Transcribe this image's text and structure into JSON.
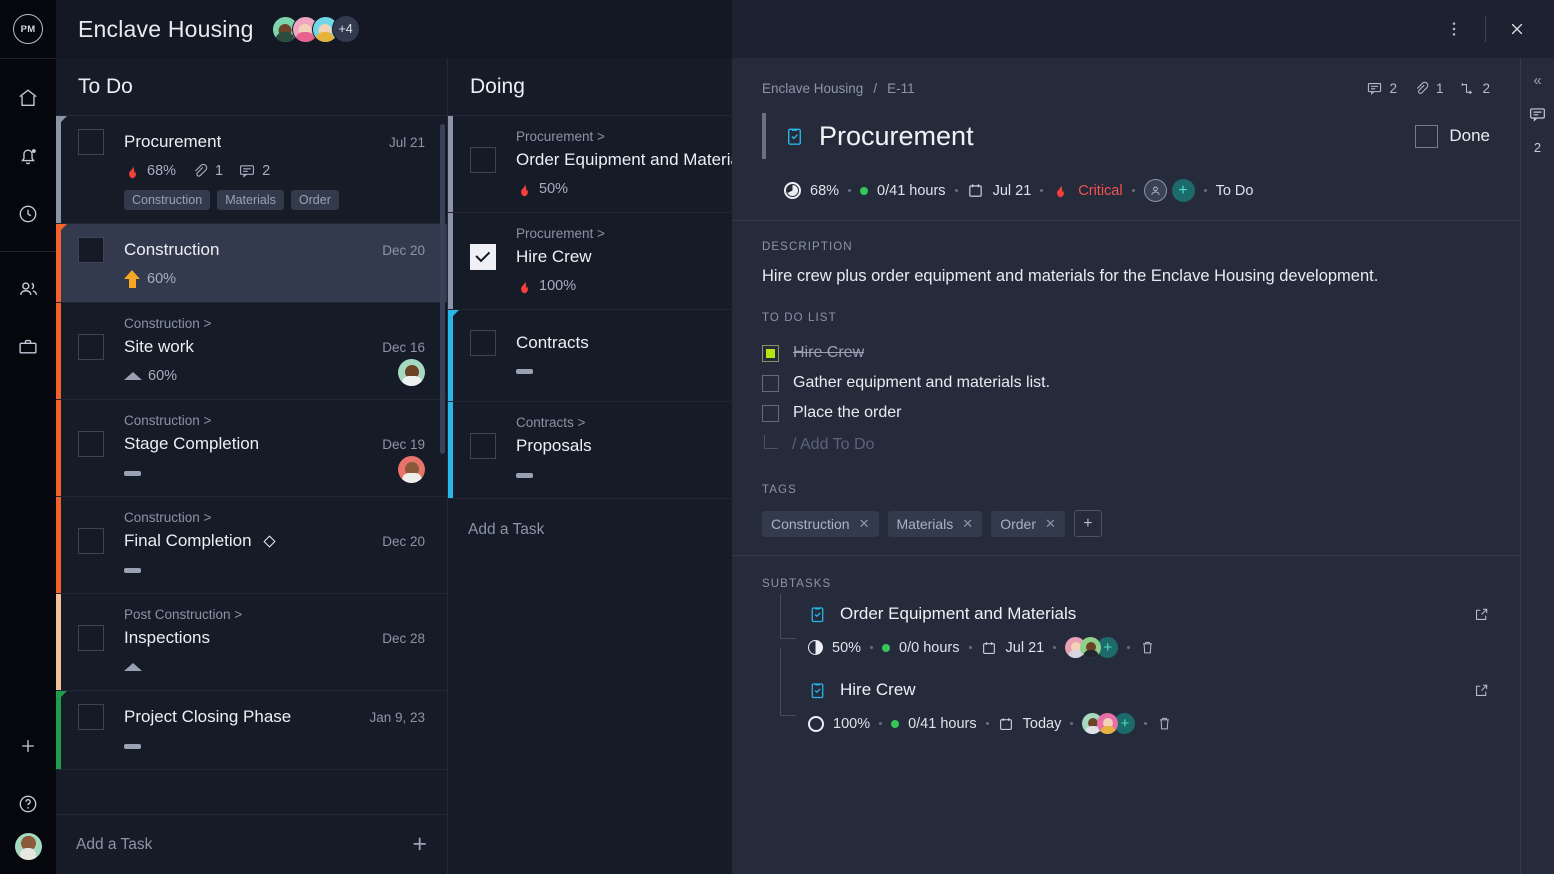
{
  "rail": {
    "logo_text": "PM",
    "items": [
      {
        "name": "home-icon",
        "label": "Home"
      },
      {
        "name": "bell-icon",
        "label": "Notifications"
      },
      {
        "name": "clock-icon",
        "label": "Recent"
      },
      {
        "name": "people-icon",
        "label": "People"
      },
      {
        "name": "briefcase-icon",
        "label": "Portfolio"
      }
    ],
    "add_label": "+",
    "help_label": "?"
  },
  "topbar": {
    "project_title": "Enclave Housing",
    "avatar_overflow": "+4",
    "views": [
      {
        "name": "list-view",
        "active": false
      },
      {
        "name": "board-view",
        "active": true
      },
      {
        "name": "gantt-view",
        "active": false
      }
    ]
  },
  "board": {
    "columns": [
      {
        "title": "To Do",
        "add_label": "Add a Task",
        "cards": [
          {
            "name": "Procurement",
            "parent": "",
            "date": "Jul 21",
            "selected": false,
            "checked": false,
            "strip": "#8d94a8",
            "priority": "flame",
            "progress": "68%",
            "attachments": "1",
            "comments": "2",
            "tags": [
              "Construction",
              "Materials",
              "Order"
            ],
            "avatar": ""
          },
          {
            "name": "Construction",
            "parent": "",
            "date": "Dec 20",
            "selected": true,
            "checked": false,
            "strip": "#f4622c",
            "priority": "arrow-up",
            "progress": "60%",
            "attachments": "",
            "comments": "",
            "tags": [],
            "avatar": ""
          },
          {
            "name": "Site work",
            "parent": "Construction >",
            "date": "Dec 16",
            "selected": false,
            "checked": false,
            "strip": "#f4622c",
            "priority": "triangle",
            "progress": "60%",
            "attachments": "",
            "comments": "",
            "tags": [],
            "avatar": "#a5d8c0"
          },
          {
            "name": "Stage Completion",
            "parent": "Construction >",
            "date": "Dec 19",
            "selected": false,
            "checked": false,
            "strip": "#f4622c",
            "priority": "dash",
            "progress": "",
            "attachments": "",
            "comments": "",
            "tags": [],
            "avatar": "#e8736b"
          },
          {
            "name": "Final Completion",
            "parent": "Construction >",
            "date": "Dec 20",
            "selected": false,
            "checked": false,
            "strip": "#f4622c",
            "priority": "dash",
            "progress": "",
            "milestone": true,
            "attachments": "",
            "comments": "",
            "tags": [],
            "avatar": ""
          },
          {
            "name": "Inspections",
            "parent": "Post Construction >",
            "date": "Dec 28",
            "selected": false,
            "checked": false,
            "strip": "#f3c49a",
            "priority": "triangle",
            "progress": "",
            "attachments": "",
            "comments": "",
            "tags": [],
            "avatar": ""
          },
          {
            "name": "Project Closing Phase",
            "parent": "",
            "date": "Jan 9, 23",
            "selected": false,
            "checked": false,
            "strip": "#1f9d4d",
            "priority": "dash",
            "progress": "",
            "attachments": "",
            "comments": "",
            "tags": [],
            "avatar": ""
          }
        ]
      },
      {
        "title": "Doing",
        "add_label": "Add a Task",
        "cards": [
          {
            "name": "Order Equipment and Materials",
            "parent": "Procurement >",
            "date": "",
            "selected": false,
            "checked": false,
            "strip": "#8d94a8",
            "priority": "flame",
            "progress": "50%",
            "attachments": "",
            "comments": "",
            "tags": [],
            "avatar": ""
          },
          {
            "name": "Hire Crew",
            "parent": "Procurement >",
            "date": "",
            "selected": false,
            "checked": true,
            "strip": "#8d94a8",
            "priority": "flame",
            "progress": "100%",
            "attachments": "",
            "comments": "",
            "tags": [],
            "avatar": ""
          },
          {
            "name": "Contracts",
            "parent": "",
            "date": "",
            "selected": false,
            "checked": false,
            "strip": "#29b6e8",
            "priority": "dash",
            "progress": "",
            "attachments": "",
            "comments": "",
            "tags": [],
            "avatar": ""
          },
          {
            "name": "Proposals",
            "parent": "Contracts >",
            "date": "",
            "selected": false,
            "checked": false,
            "strip": "#29b6e8",
            "priority": "dash",
            "progress": "",
            "attachments": "",
            "comments": "",
            "tags": [],
            "avatar": ""
          }
        ]
      }
    ]
  },
  "detail": {
    "breadcrumb_project": "Enclave Housing",
    "breadcrumb_sep": "/",
    "breadcrumb_id": "E-11",
    "header_stats": {
      "comments": "2",
      "attachments": "1",
      "dependencies": "2"
    },
    "title": "Procurement",
    "done_label": "Done",
    "meta": {
      "progress": "68%",
      "hours": "0/41 hours",
      "due_date": "Jul 21",
      "priority": "Critical",
      "status": "To Do",
      "assign_plus": "+"
    },
    "description": {
      "label": "DESCRIPTION",
      "text": "Hire crew plus order equipment and materials for the Enclave Housing development."
    },
    "todo": {
      "label": "TO DO LIST",
      "items": [
        {
          "text": "Hire Crew",
          "done": true
        },
        {
          "text": "Gather equipment and materials list.",
          "done": false
        },
        {
          "text": "Place the order",
          "done": false
        }
      ],
      "add_placeholder": "/ Add To Do"
    },
    "tags": {
      "label": "TAGS",
      "items": [
        "Construction",
        "Materials",
        "Order"
      ],
      "remove_glyph": "✕",
      "add_glyph": "+"
    },
    "subtasks": {
      "label": "SUBTASKS",
      "items": [
        {
          "name": "Order Equipment and Materials",
          "progress": "50%",
          "hours": "0/0 hours",
          "date": "Jul 21",
          "assign_plus": "+",
          "avatars": [
            "#e8a0b4",
            "#8fd18a"
          ]
        },
        {
          "name": "Hire Crew",
          "progress": "100%",
          "hours": "0/41 hours",
          "date": "Today",
          "assign_plus": "+",
          "avatars": [
            "#8a5a3b",
            "#e86fa8"
          ]
        }
      ]
    },
    "rightbar": {
      "collapse_glyph": "«",
      "comment_count": "2"
    }
  },
  "colors": {
    "accent_cyan": "#29b6e8",
    "accent_orange": "#f4622c",
    "critical_red": "#f4514f",
    "green": "#34c759",
    "teal": "#1d6a6b"
  }
}
